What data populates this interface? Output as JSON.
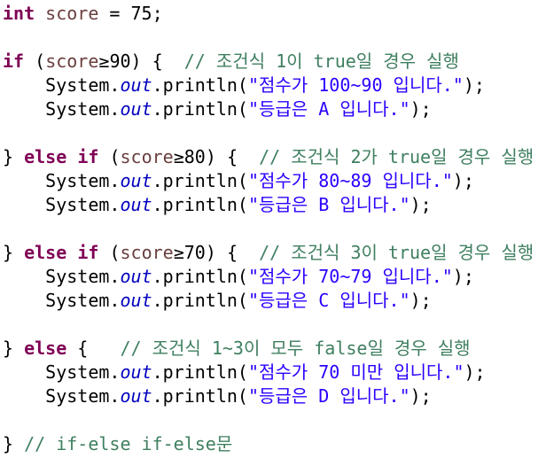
{
  "code": {
    "line1": {
      "kw_int": "int",
      "space1": " ",
      "var": "score",
      "assign": " = ",
      "num": "75",
      "semi": ";"
    },
    "line3": {
      "kw_if": "if",
      "open": " (",
      "var": "score",
      "op": "≥",
      "num": "90",
      "close": ") {  ",
      "comment": "// 조건식 1이 true일 경우 실행"
    },
    "line4": {
      "indent": "    ",
      "system": "System.",
      "out": "out",
      "println": ".println(",
      "str": "\"점수가 100~90 입니다.\"",
      "end": ");"
    },
    "line5": {
      "indent": "    ",
      "system": "System.",
      "out": "out",
      "println": ".println(",
      "str": "\"등급은 A 입니다.\"",
      "end": ");"
    },
    "line7": {
      "brace": "} ",
      "kw_else": "else",
      "sp": " ",
      "kw_if": "if",
      "open": " (",
      "var": "score",
      "op": "≥",
      "num": "80",
      "close": ") {  ",
      "comment": "// 조건식 2가 true일 경우 실행"
    },
    "line8": {
      "indent": "    ",
      "system": "System.",
      "out": "out",
      "println": ".println(",
      "str": "\"점수가 80~89 입니다.\"",
      "end": ");"
    },
    "line9": {
      "indent": "    ",
      "system": "System.",
      "out": "out",
      "println": ".println(",
      "str": "\"등급은 B 입니다.\"",
      "end": ");"
    },
    "line11": {
      "brace": "} ",
      "kw_else": "else",
      "sp": " ",
      "kw_if": "if",
      "open": " (",
      "var": "score",
      "op": "≥",
      "num": "70",
      "close": ") {  ",
      "comment": "// 조건식 3이 true일 경우 실행"
    },
    "line12": {
      "indent": "    ",
      "system": "System.",
      "out": "out",
      "println": ".println(",
      "str": "\"점수가 70~79 입니다.\"",
      "end": ");"
    },
    "line13": {
      "indent": "    ",
      "system": "System.",
      "out": "out",
      "println": ".println(",
      "str": "\"등급은 C 입니다.\"",
      "end": ");"
    },
    "line15": {
      "brace": "} ",
      "kw_else": "else",
      "open": " {   ",
      "comment": "// 조건식 1~3이 모두 false일 경우 실행"
    },
    "line16": {
      "indent": "    ",
      "system": "System.",
      "out": "out",
      "println": ".println(",
      "str": "\"점수가 70 미만 입니다.\"",
      "end": ");"
    },
    "line17": {
      "indent": "    ",
      "system": "System.",
      "out": "out",
      "println": ".println(",
      "str": "\"등급은 D 입니다.\"",
      "end": ");"
    },
    "line19": {
      "brace": "} ",
      "comment": "// if-else if-else문"
    }
  },
  "colors": {
    "keyword": "#7f0055",
    "variable": "#6a3e3e",
    "string": "#2a00ff",
    "comment": "#3f7f5f",
    "static_field": "#0000c0"
  }
}
